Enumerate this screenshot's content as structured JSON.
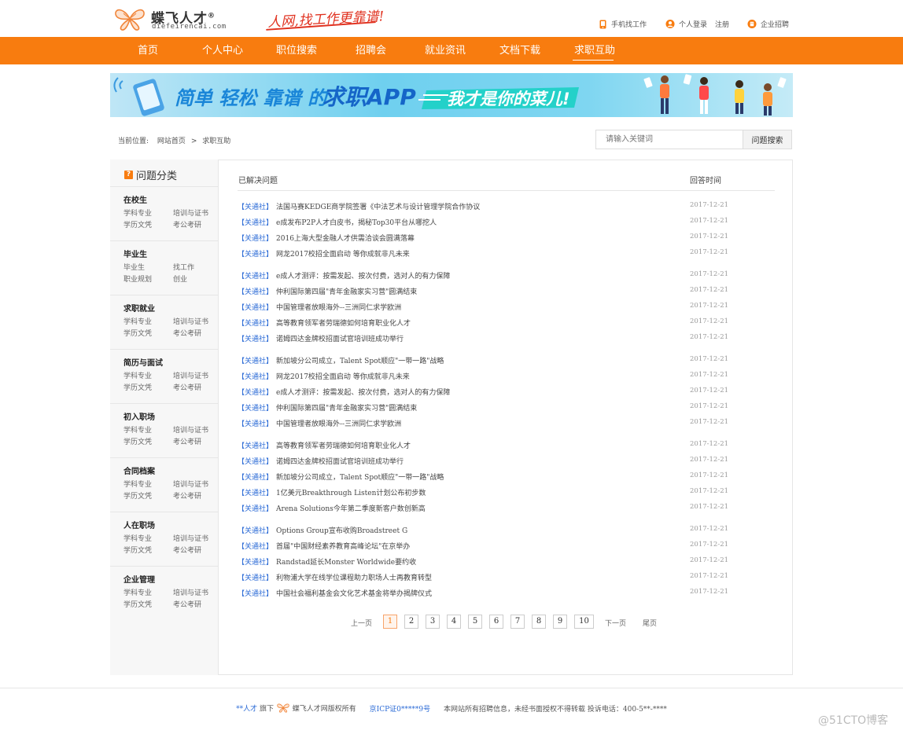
{
  "header": {
    "logo_name": "蝶飞人才",
    "logo_reg": "®",
    "logo_domain": "diefeirencai.com",
    "slogan": "人网,找工作更靠谱!",
    "links": [
      {
        "label": "手机找工作",
        "icon": "phone-icon"
      },
      {
        "label": "个人登录",
        "icon": "user-icon"
      },
      {
        "label": "注册"
      },
      {
        "label": "企业招聘",
        "icon": "company-icon"
      }
    ]
  },
  "nav": {
    "items": [
      "首页",
      "个人中心",
      "职位搜索",
      "招聘会",
      "就业资讯",
      "文档下载",
      "求职互助"
    ],
    "active_index": 6
  },
  "banner": {
    "text1": "简单 轻松 靠谱 的",
    "text2": "求职APP",
    "text3": "我才是你的菜儿!"
  },
  "breadcrumb": {
    "label": "当前位置:",
    "items": [
      "网站首页",
      "求职互助"
    ],
    "sep": ">"
  },
  "search": {
    "placeholder": "请输入关键词",
    "button": "问题搜索"
  },
  "sidebar": {
    "title": "问题分类",
    "categories": [
      {
        "title": "在校生",
        "links": [
          "学科专业",
          "培训与证书",
          "学历文凭",
          "考公考研"
        ]
      },
      {
        "title": "毕业生",
        "links": [
          "毕业生",
          "找工作",
          "职业规划",
          "创业"
        ]
      },
      {
        "title": "求职就业",
        "links": [
          "学科专业",
          "培训与证书",
          "学历文凭",
          "考公考研"
        ]
      },
      {
        "title": "简历与面试",
        "links": [
          "学科专业",
          "培训与证书",
          "学历文凭",
          "考公考研"
        ]
      },
      {
        "title": "初入职场",
        "links": [
          "学科专业",
          "培训与证书",
          "学历文凭",
          "考公考研"
        ]
      },
      {
        "title": "合同档案",
        "links": [
          "学科专业",
          "培训与证书",
          "学历文凭",
          "考公考研"
        ]
      },
      {
        "title": "人在职场",
        "links": [
          "学科专业",
          "培训与证书",
          "学历文凭",
          "考公考研"
        ]
      },
      {
        "title": "企业管理",
        "links": [
          "学科专业",
          "培训与证书",
          "学历文凭",
          "考公考研"
        ]
      }
    ]
  },
  "list": {
    "head_left": "已解决问题",
    "head_right": "回答时间",
    "tag": "【关通社】",
    "groups": [
      [
        {
          "title": "法国马赛KEDGE商学院签署《中法艺术与设计管理学院合作协议",
          "date": "2017-12-21"
        },
        {
          "title": "e成发布P2P人才白皮书，揭秘Top30平台从哪挖人",
          "date": "2017-12-21"
        },
        {
          "title": "2016上海大型金融人才供需洽谈会圆满落幕",
          "date": "2017-12-21"
        },
        {
          "title": "网龙2017校招全面启动 等你成就非凡未来",
          "date": "2017-12-21"
        }
      ],
      [
        {
          "title": "e成人才测评：按需发起、按次付费，选对人的有力保障",
          "date": "2017-12-21"
        },
        {
          "title": "仲利国际第四届\"青年金融家实习营\"圆满结束",
          "date": "2017-12-21"
        },
        {
          "title": "中国管理者放眼海外--三洲同仁求学欧洲",
          "date": "2017-12-21"
        },
        {
          "title": "高等教育领军者劳瑞德如何培育职业化人才",
          "date": "2017-12-21"
        },
        {
          "title": "诺姆四达金牌校招面试官培训班成功举行",
          "date": "2017-12-21"
        }
      ],
      [
        {
          "title": "新加坡分公司成立，Talent Spot顺应\"一带一路\"战略",
          "date": "2017-12-21"
        },
        {
          "title": "网龙2017校招全面启动 等你成就非凡未来",
          "date": "2017-12-21"
        },
        {
          "title": "e成人才测评：按需发起、按次付费，选对人的有力保障",
          "date": "2017-12-21"
        },
        {
          "title": "仲利国际第四届\"青年金融家实习营\"圆满结束",
          "date": "2017-12-21"
        },
        {
          "title": "中国管理者放眼海外--三洲同仁求学欧洲",
          "date": "2017-12-21"
        }
      ],
      [
        {
          "title": "高等教育领军者劳瑞德如何培育职业化人才",
          "date": "2017-12-21"
        },
        {
          "title": "诺姆四达金牌校招面试官培训班成功举行",
          "date": "2017-12-21"
        },
        {
          "title": "新加坡分公司成立，Talent Spot顺应\"一带一路\"战略",
          "date": "2017-12-21"
        },
        {
          "title": "1亿美元Breakthrough Listen计划公布初步数",
          "date": "2017-12-21"
        },
        {
          "title": "Arena Solutions今年第二季度新客户数创新高",
          "date": "2017-12-21"
        }
      ],
      [
        {
          "title": "Options Group宣布收购Broadstreet G",
          "date": "2017-12-21"
        },
        {
          "title": "首届\"中国财经素养教育高峰论坛\"在京举办",
          "date": "2017-12-21"
        },
        {
          "title": "Randstad延长Monster Worldwide要约收",
          "date": "2017-12-21"
        },
        {
          "title": "利物浦大学在线学位课程助力职场人士再教育转型",
          "date": "2017-12-21"
        },
        {
          "title": "中国社会福利基金会文化艺术基金将举办揭牌仪式",
          "date": "2017-12-21"
        }
      ]
    ]
  },
  "pager": {
    "prev": "上一页",
    "pages": [
      "1",
      "2",
      "3",
      "4",
      "5",
      "6",
      "7",
      "8",
      "9",
      "10"
    ],
    "current": "1",
    "next": "下一页",
    "last": "尾页"
  },
  "footer": {
    "part1": "**人才",
    "part2": "旗下",
    "part3": "蝶飞人才网版权所有",
    "icp": "京ICP证0*****9号",
    "part4": "本网站所有招聘信息，未经书面授权不得转载 投诉电话：400-5**-****"
  },
  "watermark": "@51CTO博客",
  "colors": {
    "brand": "#f87c0f",
    "link": "#2a6ad6"
  }
}
